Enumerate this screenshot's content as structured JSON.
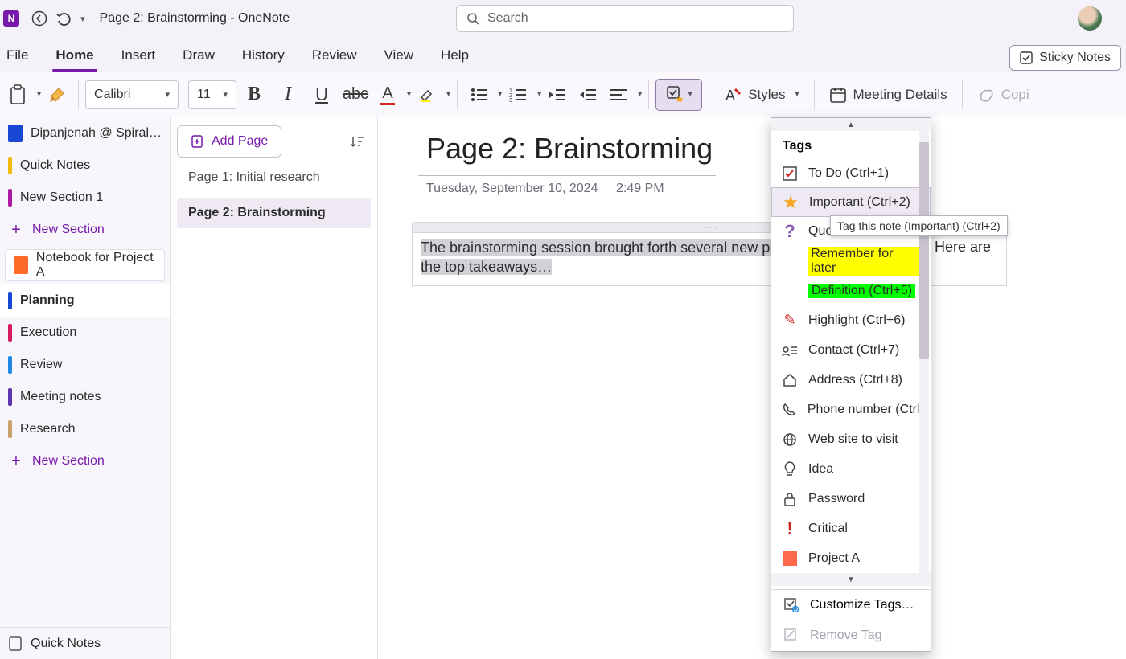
{
  "titlebar": {
    "title": "Page 2: Brainstorming  -  OneNote",
    "search_placeholder": "Search"
  },
  "menu": {
    "items": [
      "File",
      "Home",
      "Insert",
      "Draw",
      "History",
      "Review",
      "View",
      "Help"
    ],
    "active": "Home",
    "sticky": "Sticky Notes"
  },
  "ribbon": {
    "font": "Calibri",
    "size": "11",
    "styles_label": "Styles",
    "meeting_label": "Meeting Details",
    "copy_label": "Copi"
  },
  "sidebar": {
    "account": "Dipanjenah @ Spiral…",
    "items": [
      {
        "label": "Quick Notes",
        "color": "#f2b90f"
      },
      {
        "label": "New Section 1",
        "color": "#b01ba5"
      }
    ],
    "new1": "New Section",
    "notebook": "Notebook for Project A",
    "sections": [
      {
        "label": "Planning",
        "color": "#1846d5",
        "active": true
      },
      {
        "label": "Execution",
        "color": "#d81b60"
      },
      {
        "label": "Review",
        "color": "#1e88e5"
      },
      {
        "label": "Meeting notes",
        "color": "#5e35b1"
      },
      {
        "label": "Research",
        "color": "#c9a26b"
      }
    ],
    "new2": "New Section",
    "bottom": "Quick Notes"
  },
  "pagelist": {
    "add": "Add Page",
    "pages": [
      {
        "label": "Page 1: Initial research",
        "active": false
      },
      {
        "label": "Page 2: Brainstorming",
        "active": true
      }
    ]
  },
  "canvas": {
    "title": "Page 2: Brainstorming",
    "date": "Tuesday, September 10, 2024",
    "time": "2:49 PM",
    "body1": "The brainstorming session brought forth several new pers",
    "body2": "the top takeaways…",
    "right_fragment": "Here are"
  },
  "tags": {
    "header": "Tags",
    "items": [
      {
        "label": "To Do (Ctrl+1)",
        "icon": "checkbox"
      },
      {
        "label": "Important (Ctrl+2)",
        "icon": "star",
        "hover": true
      },
      {
        "label": "Que",
        "icon": "question"
      },
      {
        "label": "Remember for later",
        "icon": "none",
        "hl": "yellow"
      },
      {
        "label": "Definition (Ctrl+5)",
        "icon": "none",
        "hl": "green"
      },
      {
        "label": "Highlight (Ctrl+6)",
        "icon": "pencil"
      },
      {
        "label": "Contact (Ctrl+7)",
        "icon": "contact"
      },
      {
        "label": "Address (Ctrl+8)",
        "icon": "home"
      },
      {
        "label": "Phone number (Ctrl+",
        "icon": "phone"
      },
      {
        "label": "Web site to visit",
        "icon": "globe"
      },
      {
        "label": "Idea",
        "icon": "bulb"
      },
      {
        "label": "Password",
        "icon": "lock"
      },
      {
        "label": "Critical",
        "icon": "bang"
      },
      {
        "label": "Project A",
        "icon": "square"
      }
    ],
    "customize": "Customize Tags…",
    "remove": "Remove Tag",
    "tooltip": "Tag this note (Important) (Ctrl+2)"
  }
}
